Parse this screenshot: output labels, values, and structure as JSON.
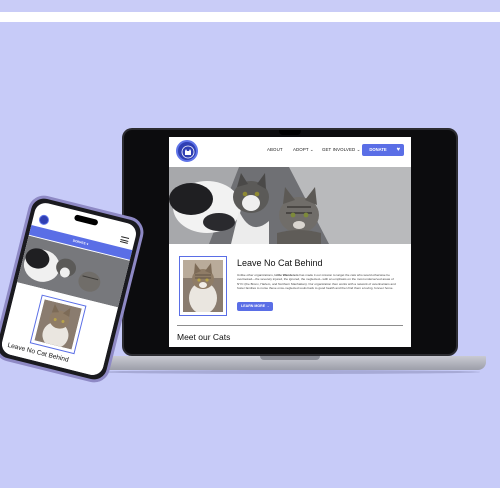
{
  "site": {
    "nav": {
      "about": "ABOUT",
      "adopt": "ADOPT",
      "get_involved": "GET INVOLVED",
      "donate": "DONATE"
    },
    "intro": {
      "title": "Leave No Cat Behind",
      "text_a": "Unlike other organizations, ",
      "org_name": "Little Wanderers",
      "text_b": " has made it our mission to target the cats who would otherwise be overlooked—the severely injured, the ignored, the neglected—with an emphasis on the most underserved areas of NYC (the Bronx, Harlem, and Northern Manhattan). Our organization then works with a network of veterinarians and foster families to nurse these once-neglected souls back to good health and then find them a loving, forever home.",
      "learn_more": "LEARN MORE"
    },
    "meet_heading": "Meet our Cats",
    "carousel": {
      "slides": 2,
      "active": 1
    }
  },
  "phone": {
    "donate": "DONATE",
    "title": "Leave No Cat Behind"
  },
  "colors": {
    "backdrop": "#c7cbf8",
    "accent": "#5a6ee6",
    "logo": "#2f3fb3",
    "phone_frame": "#8e89c5"
  },
  "icons": {
    "logo": "cat-logo-icon",
    "heart": "heart-icon",
    "chevron": "chevron-down-icon",
    "menu": "hamburger-menu-icon",
    "arrow": "arrow-right-icon"
  }
}
